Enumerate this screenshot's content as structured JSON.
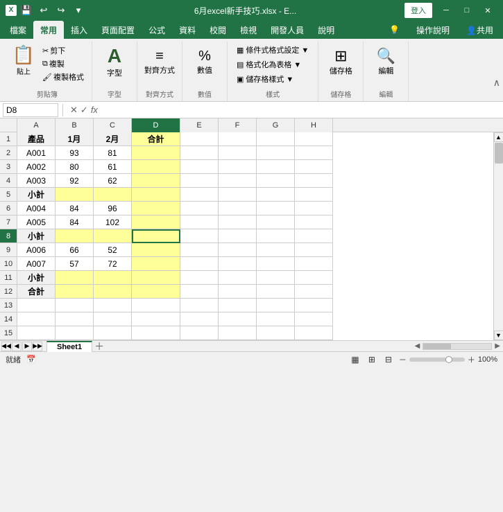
{
  "titleBar": {
    "filename": "6月excel新手技巧.xlsx - E...",
    "loginBtn": "登入",
    "quickAccess": [
      "💾",
      "↩",
      "↪",
      "▼"
    ]
  },
  "ribbonTabs": {
    "tabs": [
      "檔案",
      "常用",
      "插入",
      "頁面配置",
      "公式",
      "資料",
      "校閱",
      "檢視",
      "開發人員",
      "說明"
    ],
    "active": "常用",
    "rightTabs": [
      "💡",
      "操作說明",
      "👤共用"
    ]
  },
  "ribbon": {
    "groups": [
      {
        "label": "剪貼簿",
        "buttons": [
          "貼上",
          "剪下",
          "複製",
          "複製格式"
        ]
      },
      {
        "label": "字型",
        "name": "字型"
      },
      {
        "label": "對齊方式",
        "name": "對齊方式"
      },
      {
        "label": "數值",
        "name": "數值"
      },
      {
        "label": "樣式",
        "items": [
          "條件式格式設定 ▼",
          "格式化為表格 ▼",
          "儲存格樣式 ▼"
        ]
      },
      {
        "label": "儲存格",
        "name": "儲存格"
      },
      {
        "label": "編輯",
        "name": "編輯"
      }
    ]
  },
  "formulaBar": {
    "cellRef": "D8",
    "formula": ""
  },
  "columns": {
    "widths": [
      55,
      55,
      55,
      70,
      55,
      55,
      55,
      55
    ],
    "labels": [
      "A",
      "B",
      "C",
      "D",
      "E",
      "F",
      "G",
      "H"
    ]
  },
  "rows": {
    "count": 15,
    "data": [
      [
        "產品",
        "1月",
        "2月",
        "合計",
        "",
        "",
        "",
        ""
      ],
      [
        "A001",
        "93",
        "81",
        "",
        "",
        "",
        "",
        ""
      ],
      [
        "A002",
        "80",
        "61",
        "",
        "",
        "",
        "",
        ""
      ],
      [
        "A003",
        "92",
        "62",
        "",
        "",
        "",
        "",
        ""
      ],
      [
        "小計",
        "",
        "",
        "",
        "",
        "",
        "",
        ""
      ],
      [
        "A004",
        "84",
        "96",
        "",
        "",
        "",
        "",
        ""
      ],
      [
        "A005",
        "84",
        "102",
        "",
        "",
        "",
        "",
        ""
      ],
      [
        "小計",
        "",
        "",
        "",
        "",
        "",
        "",
        ""
      ],
      [
        "A006",
        "66",
        "52",
        "",
        "",
        "",
        "",
        ""
      ],
      [
        "A007",
        "57",
        "72",
        "",
        "",
        "",
        "",
        ""
      ],
      [
        "小計",
        "",
        "",
        "",
        "",
        "",
        "",
        ""
      ],
      [
        "合計",
        "",
        "",
        "",
        "",
        "",
        "",
        ""
      ],
      [
        "",
        "",
        "",
        "",
        "",
        "",
        "",
        ""
      ],
      [
        "",
        "",
        "",
        "",
        "",
        "",
        "",
        ""
      ],
      [
        "",
        "",
        "",
        "",
        "",
        "",
        "",
        ""
      ]
    ]
  },
  "sheets": {
    "tabs": [
      "Sheet1"
    ],
    "active": "Sheet1"
  },
  "statusBar": {
    "status": "就緒",
    "zoom": "100%"
  }
}
